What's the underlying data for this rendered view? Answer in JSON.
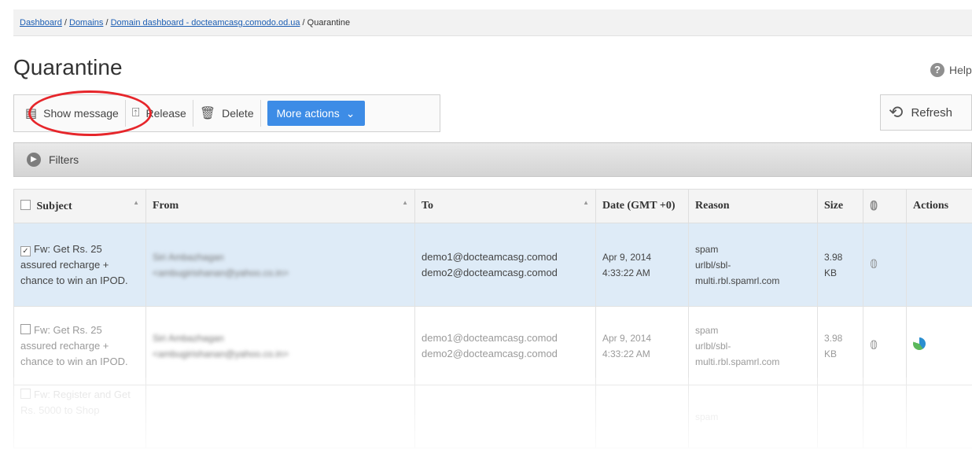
{
  "breadcrumb": {
    "items": [
      "Dashboard",
      "Domains",
      "Domain dashboard - docteamcasg.comodo.od.ua"
    ],
    "current": "Quarantine",
    "separator": " / "
  },
  "page": {
    "title": "Quarantine"
  },
  "help": {
    "label": "Help",
    "icon": "question-icon"
  },
  "toolbar": {
    "show_message": "Show message",
    "release": "Release",
    "delete": "Delete",
    "more_actions": "More actions"
  },
  "refresh": {
    "label": "Refresh"
  },
  "filters": {
    "label": "Filters"
  },
  "table": {
    "headers": {
      "subject": "Subject",
      "from": "From",
      "to": "To",
      "date": "Date (GMT +0)",
      "reason": "Reason",
      "size": "Size",
      "actions": "Actions"
    },
    "rows": [
      {
        "checked": true,
        "subject": "Fw: Get Rs. 25 assured recharge + chance to win an IPOD.",
        "from_name": "Siri Ambazhagan",
        "from_email": "<ambugirishanan@yahoo.co.in>",
        "to_1": "demo1@docteamcasg.comod",
        "to_2": "demo2@docteamcasg.comod",
        "date_1": "Apr 9, 2014",
        "date_2": "4:33:22 AM",
        "reason_1": "spam",
        "reason_2": "urlbl/sbl-",
        "reason_3": "multi.rbl.spamrl.com",
        "size_1": "3.98",
        "size_2": "KB"
      },
      {
        "checked": false,
        "subject": "Fw: Get Rs. 25 assured recharge + chance to win an IPOD.",
        "from_name": "Siri Ambazhagan",
        "from_email": "<ambugirishanan@yahoo.co.in>",
        "to_1": "demo1@docteamcasg.comod",
        "to_2": "demo2@docteamcasg.comod",
        "date_1": "Apr 9, 2014",
        "date_2": "4:33:22 AM",
        "reason_1": "spam",
        "reason_2": "urlbl/sbl-",
        "reason_3": "multi.rbl.spamrl.com",
        "size_1": "3.98",
        "size_2": "KB"
      },
      {
        "checked": false,
        "subject": "Fw: Register and Get Rs. 5000 to Shop",
        "reason_1": "spam"
      }
    ]
  },
  "colors": {
    "accent": "#3d8ce6",
    "selected_row": "#deebf7",
    "highlight_ring": "#e6262b",
    "link": "#1d5fb4"
  }
}
